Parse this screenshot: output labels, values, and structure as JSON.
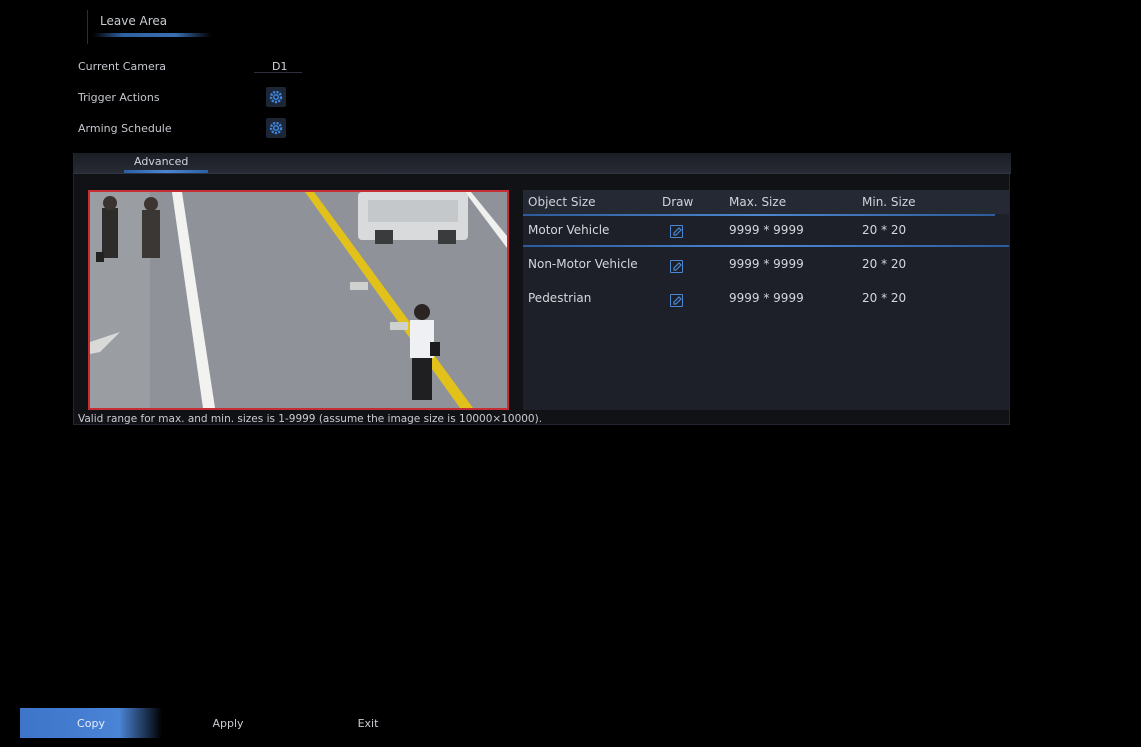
{
  "top_tab": {
    "label": "Leave Area"
  },
  "form": {
    "current_camera_label": "Current Camera",
    "current_camera_value": "D1",
    "trigger_actions_label": "Trigger Actions",
    "arming_schedule_label": "Arming Schedule"
  },
  "advanced": {
    "tab_label": "Advanced",
    "table": {
      "headers": [
        "Object Size",
        "Draw",
        "Max. Size",
        "Min. Size"
      ],
      "rows": [
        {
          "object": "Motor Vehicle",
          "max": "9999 * 9999",
          "min": "20 * 20"
        },
        {
          "object": "Non-Motor Vehicle",
          "max": "9999 * 9999",
          "min": "20 * 20"
        },
        {
          "object": "Pedestrian",
          "max": "9999 * 9999",
          "min": "20 * 20"
        }
      ]
    },
    "note": "Valid range for max. and min. sizes is 1-9999 (assume the image size is 10000×10000)."
  },
  "buttons": {
    "copy": "Copy",
    "apply": "Apply",
    "exit": "Exit"
  },
  "colors": {
    "accent": "#4a84d6",
    "frame": "#c62e34",
    "background": "#000000"
  },
  "icons": {
    "settings": "gear-icon",
    "draw": "edit-icon"
  }
}
